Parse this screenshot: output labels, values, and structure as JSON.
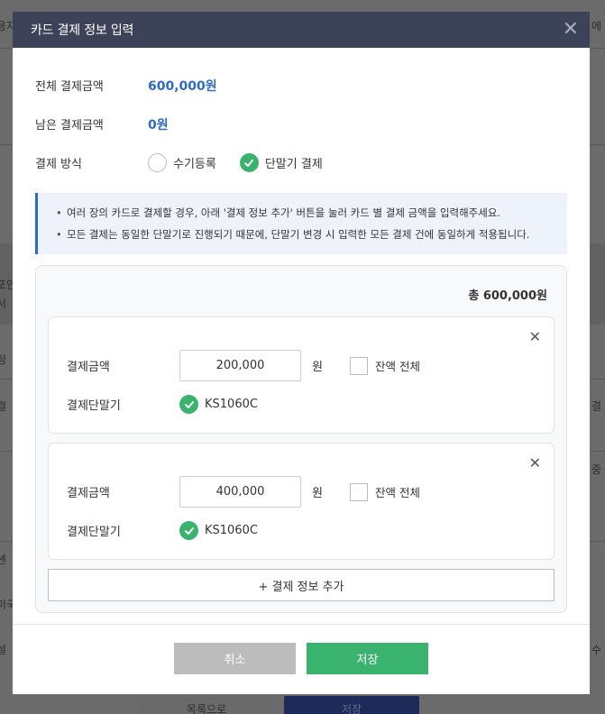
{
  "background": {
    "fragments": [
      "용자",
      "에",
      "포인",
      "서",
      "정",
      "결",
      "결",
      "중 (",
      "센",
      "미국",
      "설",
      "수"
    ],
    "buttons": [
      "목록으로",
      "저장"
    ]
  },
  "modal": {
    "title": "카드 결제 정보 입력",
    "total_label": "전체 결제금액",
    "total_value": "600,000원",
    "remaining_label": "남은 결제금액",
    "remaining_value": "0원",
    "method_label": "결제 방식",
    "method_options": [
      {
        "label": "수기등록",
        "checked": false
      },
      {
        "label": "단말기 결제",
        "checked": true
      }
    ],
    "notices": [
      "여러 장의 카드로 결제할 경우, 아래 '결제 정보 추가' 버튼을 눌러 카드 별 결제 금액을 입력해주세요.",
      "모든 결제는 동일한 단말기로 진행되기 때문에, 단말기 변경 시 입력한 모든 결제 건에 동일하게 적용됩니다."
    ],
    "sum_total": "총 600,000원",
    "payments": [
      {
        "amount_label": "결제금액",
        "amount": "200,000",
        "unit": "원",
        "remaining_all_label": "잔액 전체",
        "terminal_label": "결제단말기",
        "terminal": "KS1060C"
      },
      {
        "amount_label": "결제금액",
        "amount": "400,000",
        "unit": "원",
        "remaining_all_label": "잔액 전체",
        "terminal_label": "결제단말기",
        "terminal": "KS1060C"
      }
    ],
    "add_button": "+ 결제 정보 추가",
    "cancel_button": "취소",
    "save_button": "저장"
  },
  "colors": {
    "header_bg": "#3c4257",
    "accent_blue": "#2f6bc2",
    "accent_green": "#3ab36e",
    "cancel_gray": "#bcbcbc"
  }
}
